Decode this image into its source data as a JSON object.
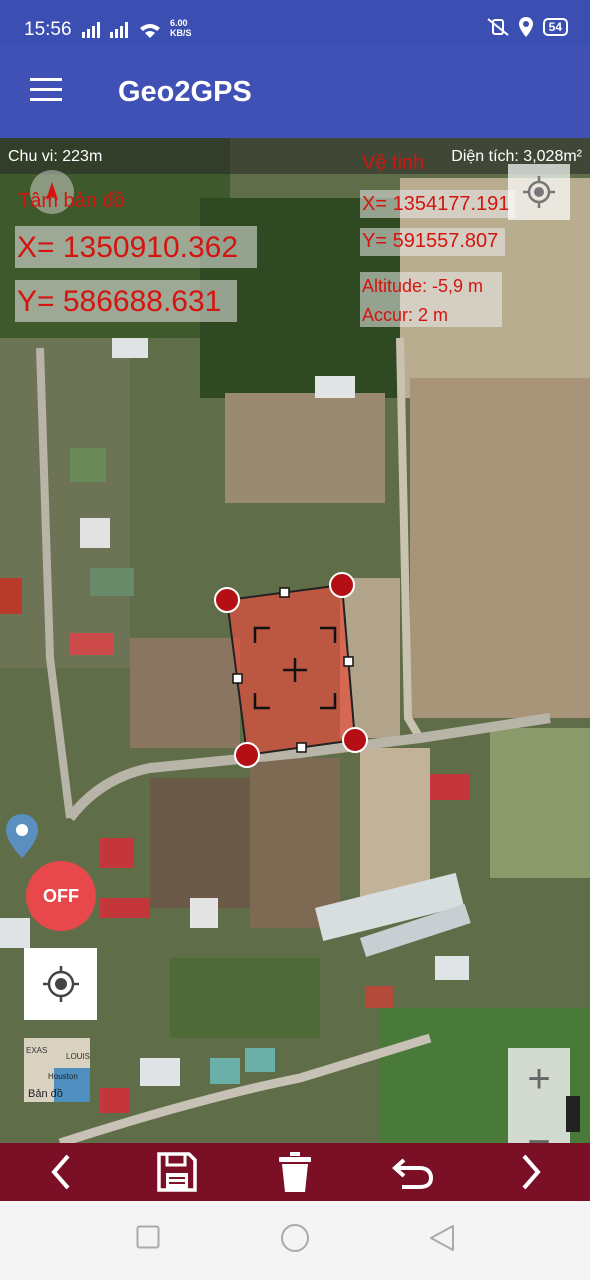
{
  "status_bar": {
    "time": "15:56",
    "net_speed": "6.00",
    "net_unit": "KB/S",
    "battery": "54"
  },
  "app_bar": {
    "title": "Geo2GPS",
    "menu_icon": "hamburger-menu-icon"
  },
  "map": {
    "perimeter": "Chu vi: 223m",
    "area": "Diện tích: 3,028m²",
    "map_center": {
      "label": "Tâm bản đồ",
      "x": "X= 1350910.362",
      "y": "Y= 586688.631"
    },
    "satellite": {
      "label": "Vệ tinh",
      "x": "X= 1354177.191",
      "y": "Y= 591557.807",
      "altitude": "Altitude: -5,9 m",
      "accuracy": "Accur: 2 m"
    },
    "off_button": "OFF",
    "layer_button_label": "Bản đồ",
    "layer_thumb_labels": [
      "EXAS",
      "LOUIS",
      "Houston"
    ],
    "zoom_in": "+",
    "zoom_out": "−",
    "polygon_color": "#e0503f",
    "vertex_color": "#b30f14"
  },
  "toolbar": {
    "icons": [
      "chevron-left-icon",
      "save-icon",
      "trash-icon",
      "undo-icon",
      "chevron-right-icon"
    ],
    "background": "#7a0f25"
  },
  "nav_bar": {
    "icons": [
      "recent-apps-icon",
      "home-icon",
      "back-icon"
    ]
  }
}
